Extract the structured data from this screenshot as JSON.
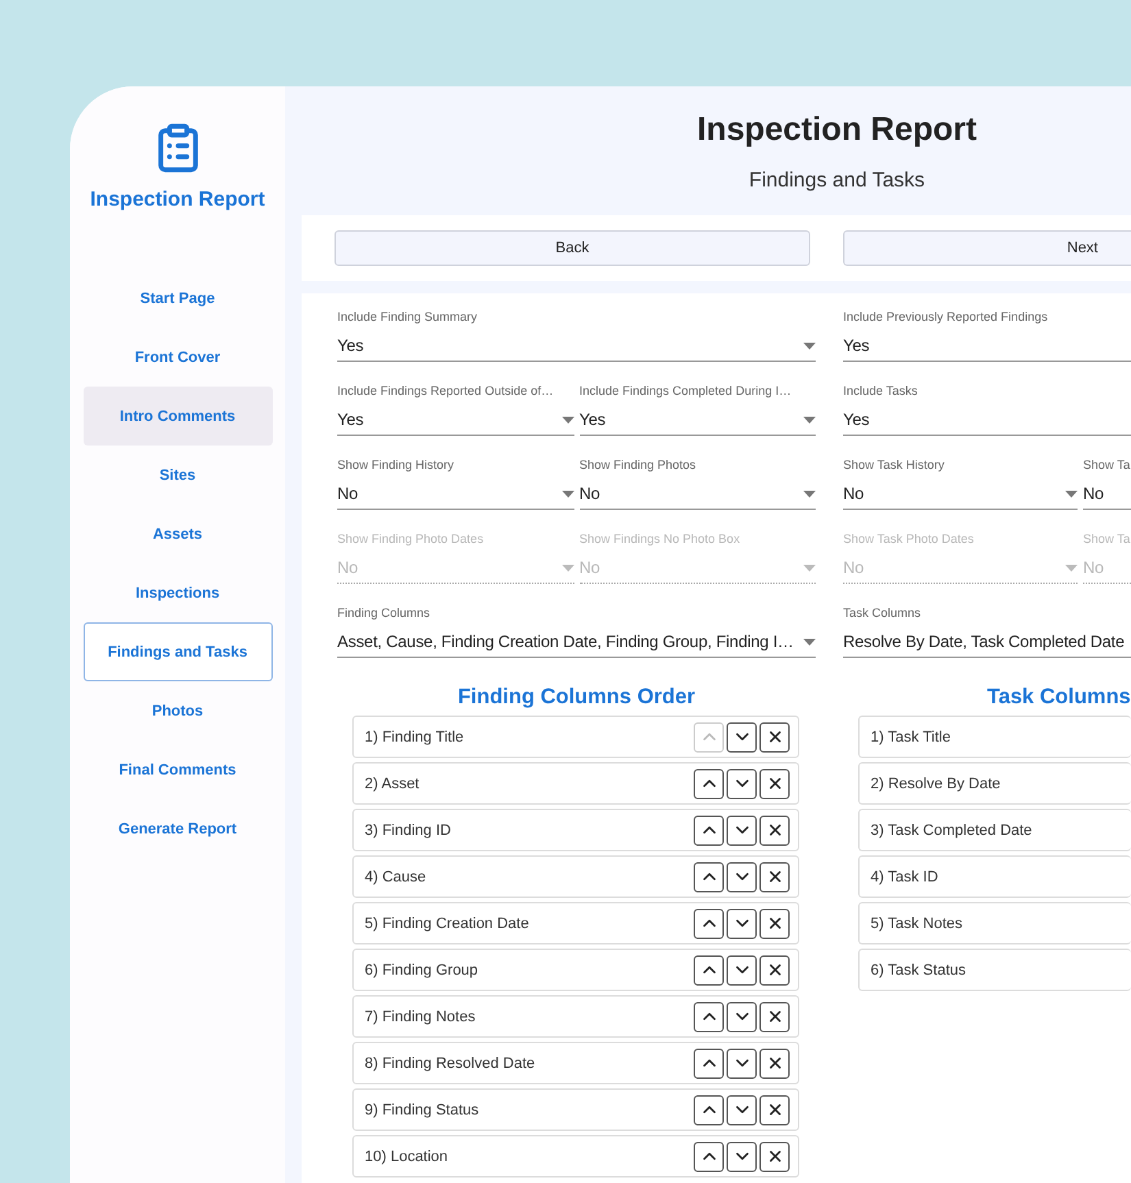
{
  "sidebar": {
    "title": "Inspection Report",
    "items": [
      {
        "label": "Start Page",
        "selected": false,
        "hovered": false
      },
      {
        "label": "Front Cover",
        "selected": false,
        "hovered": false
      },
      {
        "label": "Intro Comments",
        "selected": false,
        "hovered": true
      },
      {
        "label": "Sites",
        "selected": false,
        "hovered": false
      },
      {
        "label": "Assets",
        "selected": false,
        "hovered": false
      },
      {
        "label": "Inspections",
        "selected": false,
        "hovered": false
      },
      {
        "label": "Findings and Tasks",
        "selected": true,
        "hovered": false
      },
      {
        "label": "Photos",
        "selected": false,
        "hovered": false
      },
      {
        "label": "Final Comments",
        "selected": false,
        "hovered": false
      },
      {
        "label": "Generate Report",
        "selected": false,
        "hovered": false
      }
    ]
  },
  "header": {
    "title": "Inspection Report",
    "subtitle": "Findings and Tasks"
  },
  "nav_buttons": [
    "Back",
    "Next"
  ],
  "finding_settings": [
    [
      {
        "label": "Include Finding Summary",
        "value": "Yes",
        "disabled": false,
        "dropdown_arrow": true
      }
    ],
    [
      {
        "label": "Include Findings Reported Outside of…",
        "value": "Yes",
        "disabled": false,
        "dropdown_arrow": true
      },
      {
        "label": "Include Findings Completed During I…",
        "value": "Yes",
        "disabled": false,
        "dropdown_arrow": true
      }
    ],
    [
      {
        "label": "Show Finding History",
        "value": "No",
        "disabled": false,
        "dropdown_arrow": true
      },
      {
        "label": "Show Finding Photos",
        "value": "No",
        "disabled": false,
        "dropdown_arrow": true
      }
    ],
    [
      {
        "label": "Show Finding Photo Dates",
        "value": "No",
        "disabled": true,
        "dropdown_arrow": true
      },
      {
        "label": "Show Findings No Photo Box",
        "value": "No",
        "disabled": true,
        "dropdown_arrow": true
      }
    ],
    [
      {
        "label": "Finding Columns",
        "value": "Asset, Cause, Finding Creation Date, Finding Group, Finding I…",
        "disabled": false,
        "dropdown_arrow": true
      }
    ]
  ],
  "task_settings": [
    [
      {
        "label": "Include Previously Reported Findings",
        "value": "Yes",
        "disabled": false,
        "dropdown_arrow": false
      }
    ],
    [
      {
        "label": "Include Tasks",
        "value": "Yes",
        "disabled": false,
        "dropdown_arrow": false
      }
    ],
    [
      {
        "label": "Show Task History",
        "value": "No",
        "disabled": false,
        "dropdown_arrow": true
      },
      {
        "label": "Show Ta",
        "value": "No",
        "disabled": false,
        "dropdown_arrow": false
      }
    ],
    [
      {
        "label": "Show Task Photo Dates",
        "value": "No",
        "disabled": true,
        "dropdown_arrow": true
      },
      {
        "label": "Show Ta",
        "value": "No",
        "disabled": true,
        "dropdown_arrow": false
      }
    ],
    [
      {
        "label": "Task Columns",
        "value": "Resolve By Date, Task Completed Date",
        "disabled": false,
        "dropdown_arrow": false
      }
    ]
  ],
  "finding_columns_order": {
    "title": "Finding Columns Order",
    "items": [
      {
        "label": "1) Finding Title",
        "up_disabled": true
      },
      {
        "label": "2) Asset",
        "up_disabled": false
      },
      {
        "label": "3) Finding ID",
        "up_disabled": false
      },
      {
        "label": "4) Cause",
        "up_disabled": false
      },
      {
        "label": "5) Finding Creation Date",
        "up_disabled": false
      },
      {
        "label": "6) Finding Group",
        "up_disabled": false
      },
      {
        "label": "7) Finding Notes",
        "up_disabled": false
      },
      {
        "label": "8) Finding Resolved Date",
        "up_disabled": false
      },
      {
        "label": "9) Finding Status",
        "up_disabled": false
      },
      {
        "label": "10) Location",
        "up_disabled": false
      }
    ]
  },
  "task_columns_order": {
    "title": "Task Columns",
    "items": [
      {
        "label": "1) Task Title"
      },
      {
        "label": "2) Resolve By Date"
      },
      {
        "label": "3) Task Completed Date"
      },
      {
        "label": "4) Task ID"
      },
      {
        "label": "5) Task Notes"
      },
      {
        "label": "6) Task Status"
      }
    ]
  }
}
